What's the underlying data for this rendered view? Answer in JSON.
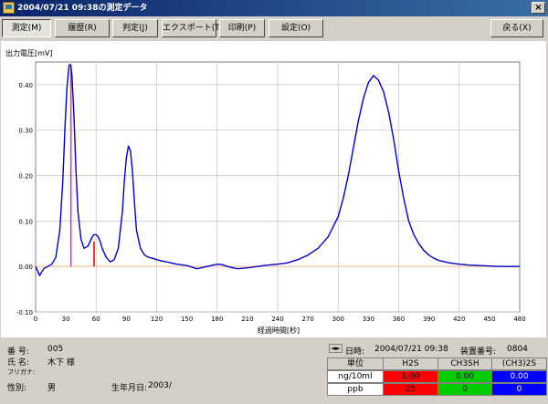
{
  "window": {
    "title": "2004/07/21 09:38の測定データ",
    "close_glyph": "×"
  },
  "toolbar": {
    "measure": "測定(M)",
    "history": "履歴(R)",
    "judge": "判定(J)",
    "export": "エクスポート(T)",
    "print": "印刷(P)",
    "settings": "設定(O)",
    "back": "戻る(X)"
  },
  "colors": {
    "curve": "#0000cc",
    "h2s": "#ff0000",
    "ch3sh": "#00cc00",
    "ch32s": "#0000ff",
    "peak_marker_1": "#c040c0",
    "peak_marker_2": "#ff0000",
    "baseline": "#ffc8a0"
  },
  "chart_data": {
    "type": "line",
    "ylabel": "出力電圧[mV]",
    "xlabel": "経過時間[秒]",
    "xlim": [
      0,
      480
    ],
    "ylim": [
      -0.1,
      0.45
    ],
    "x_ticks": [
      0,
      30,
      60,
      90,
      120,
      150,
      180,
      210,
      240,
      270,
      300,
      330,
      360,
      390,
      420,
      450,
      480
    ],
    "y_ticks": [
      {
        "value": -0.1,
        "label": "-0.10"
      },
      {
        "value": 0.0,
        "label": "0.00"
      },
      {
        "value": 0.1,
        "label": "0.10"
      },
      {
        "value": 0.2,
        "label": "0.20"
      },
      {
        "value": 0.3,
        "label": "0.30"
      },
      {
        "value": 0.4,
        "label": "0.40"
      }
    ],
    "series": [
      {
        "x": [
          0,
          2,
          4,
          8,
          12,
          16,
          20,
          24,
          27,
          29,
          31,
          33,
          34,
          35,
          36,
          38,
          40,
          42,
          45,
          48,
          52,
          56,
          58,
          60,
          62,
          64,
          66,
          70,
          74,
          78,
          82,
          86,
          88,
          90,
          92,
          94,
          96,
          98,
          100,
          104,
          108,
          112,
          116,
          120,
          125,
          130,
          140,
          150,
          160,
          170,
          180,
          185,
          190,
          200,
          210,
          220,
          230,
          240,
          250,
          260,
          270,
          280,
          290,
          300,
          305,
          310,
          315,
          320,
          325,
          330,
          335,
          340,
          345,
          350,
          355,
          360,
          365,
          370,
          375,
          380,
          385,
          390,
          395,
          400,
          410,
          420,
          430,
          440,
          450,
          460,
          470,
          480
        ],
        "y": [
          0.0,
          -0.01,
          -0.02,
          -0.005,
          0.0,
          0.005,
          0.02,
          0.08,
          0.19,
          0.3,
          0.39,
          0.44,
          0.445,
          0.44,
          0.42,
          0.33,
          0.21,
          0.12,
          0.06,
          0.04,
          0.045,
          0.065,
          0.07,
          0.07,
          0.065,
          0.055,
          0.04,
          0.02,
          0.01,
          0.015,
          0.04,
          0.12,
          0.19,
          0.24,
          0.265,
          0.255,
          0.21,
          0.14,
          0.08,
          0.04,
          0.025,
          0.02,
          0.018,
          0.015,
          0.012,
          0.01,
          0.005,
          0.002,
          -0.005,
          0.0,
          0.005,
          0.004,
          0.0,
          -0.005,
          -0.003,
          0.0,
          0.003,
          0.005,
          0.008,
          0.015,
          0.025,
          0.04,
          0.065,
          0.11,
          0.15,
          0.2,
          0.26,
          0.32,
          0.37,
          0.405,
          0.42,
          0.41,
          0.385,
          0.34,
          0.28,
          0.21,
          0.15,
          0.1,
          0.07,
          0.05,
          0.035,
          0.025,
          0.018,
          0.013,
          0.008,
          0.005,
          0.003,
          0.002,
          0.001,
          0.0,
          0.0,
          0.0
        ]
      }
    ],
    "peak_markers": [
      {
        "x": 35,
        "y_top": 0.445,
        "color": "#c040c0"
      },
      {
        "x": 58,
        "y_top": 0.055,
        "color": "#ff0000"
      }
    ]
  },
  "patient": {
    "number_label": "番  号:",
    "number": "005",
    "name_label": "氏  名:",
    "name": "木下 様",
    "furigana_label": "フリガナ:",
    "furigana": "",
    "sex_label": "性別:",
    "sex": "男",
    "birth_label": "生年月日:",
    "birth": "2003/"
  },
  "results": {
    "nav_glyph": "◄►",
    "datetime_label": "日時:",
    "datetime": "2004/07/21 09:38",
    "device_label": "装置番号:",
    "device": "0804",
    "unit_header": "単位",
    "col_h2s": "H2S",
    "col_ch3sh": "CH3SH",
    "col_ch32s": "(CH3)2S",
    "row1_unit": "ng/10ml",
    "row1_h2s": "1.00",
    "row1_ch3sh": "0.00",
    "row1_ch32s": "0.00",
    "row2_unit": "ppb",
    "row2_h2s": "25",
    "row2_ch3sh": "0",
    "row2_ch32s": "0"
  }
}
